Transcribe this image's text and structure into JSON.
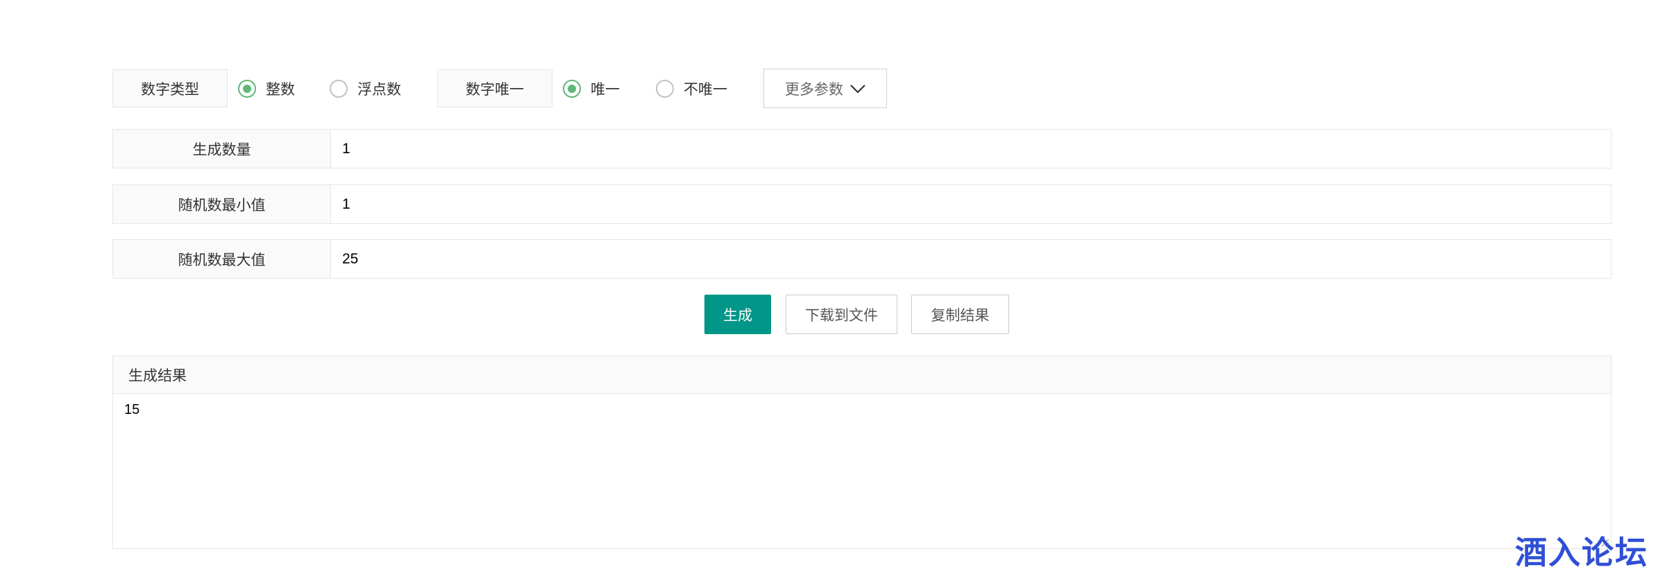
{
  "options": {
    "number_type_label": "数字类型",
    "integer_label": "整数",
    "float_label": "浮点数",
    "unique_label": "数字唯一",
    "unique_option": "唯一",
    "not_unique_option": "不唯一",
    "more_params": "更多参数",
    "selected_type": "整数",
    "selected_unique": "唯一"
  },
  "fields": {
    "count_label": "生成数量",
    "count_value": "1",
    "min_label": "随机数最小值",
    "min_value": "1",
    "max_label": "随机数最大值",
    "max_value": "25"
  },
  "buttons": {
    "generate": "生成",
    "download": "下载到文件",
    "copy": "复制结果"
  },
  "result": {
    "title": "生成结果",
    "value": "15"
  },
  "watermark": "酒入论坛",
  "colors": {
    "primary": "#009688",
    "radio_checked": "#5fb878",
    "watermark": "#2f4fd6"
  },
  "icons": {
    "more": "chevron-down-icon"
  }
}
